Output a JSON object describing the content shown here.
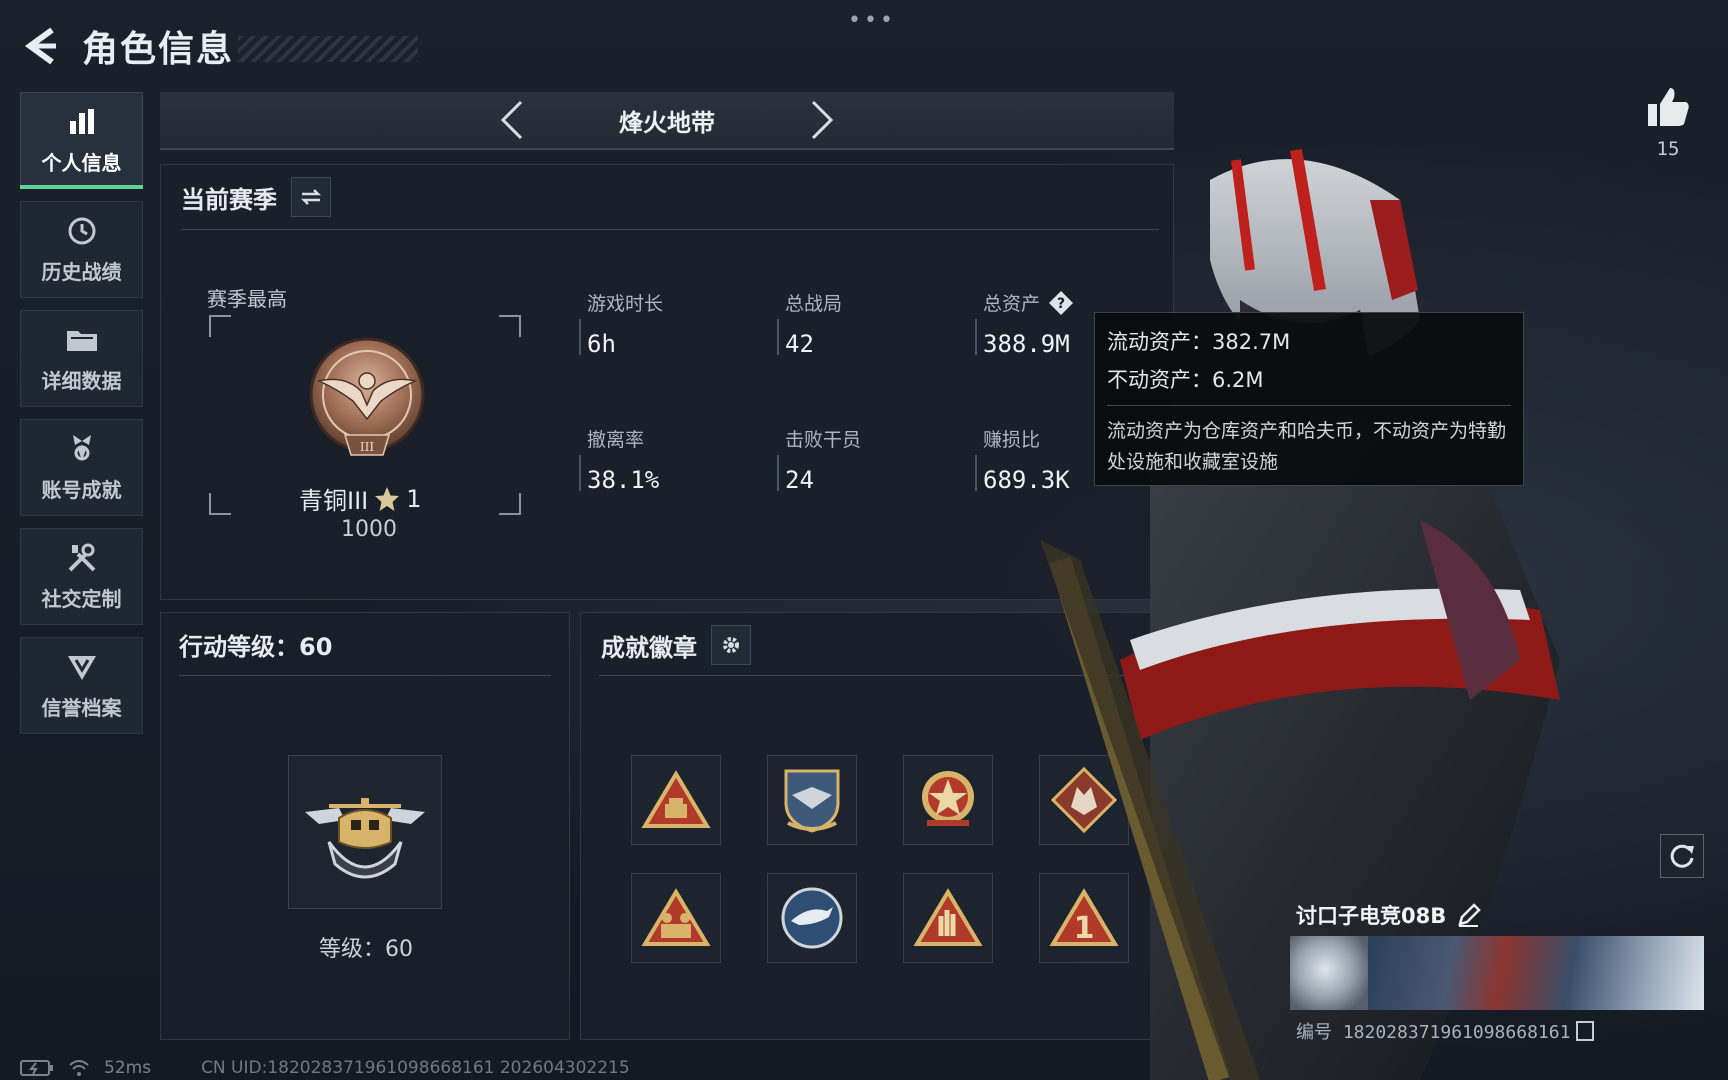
{
  "header": {
    "title": "角色信息",
    "more": "•••"
  },
  "sidebar": {
    "items": [
      {
        "label": "个人信息",
        "icon": "bar-chart-icon",
        "active": true
      },
      {
        "label": "历史战绩",
        "icon": "history-clock-icon",
        "active": false
      },
      {
        "label": "详细数据",
        "icon": "folder-icon",
        "active": false
      },
      {
        "label": "账号成就",
        "icon": "achievement-medal-icon",
        "active": false
      },
      {
        "label": "社交定制",
        "icon": "tools-icon",
        "active": false
      },
      {
        "label": "信誉档案",
        "icon": "credit-shield-icon",
        "active": false
      }
    ]
  },
  "mode": {
    "name": "烽火地带"
  },
  "season": {
    "title": "当前赛季",
    "best_label": "赛季最高",
    "rank_name": "青铜III",
    "rank_stars": "1",
    "rank_score": "1000",
    "stats": {
      "play_time": {
        "label": "游戏时长",
        "value": "6h"
      },
      "total_matches": {
        "label": "总战局",
        "value": "42"
      },
      "total_assets": {
        "label": "总资产",
        "value": "388.9M"
      },
      "extract_rate": {
        "label": "撤离率",
        "value": "38.1%"
      },
      "kills": {
        "label": "击败干员",
        "value": "24"
      },
      "profit_ratio": {
        "label": "赚损比",
        "value": "689.3K"
      }
    }
  },
  "tooltip": {
    "liquid": "流动资产：382.7M",
    "fixed": "不动资产：6.2M",
    "description": "流动资产为仓库资产和哈夫币，不动资产为特勤处设施和收藏室设施"
  },
  "action_level": {
    "title": "行动等级：60",
    "level_text": "等级：60"
  },
  "badges": {
    "title": "成就徽章",
    "items": [
      "triangle-chest-badge-icon",
      "shield-eagle-badge-icon",
      "star-wreath-badge-icon",
      "wolf-diamond-badge-icon",
      "triangle-soldiers-badge-icon",
      "eagle-round-badge-icon",
      "triangle-hand-badge-icon",
      "triangle-one-badge-icon"
    ]
  },
  "profile": {
    "likes": "15",
    "player_name": "讨口子电竞08B",
    "player_id": "编号 1820283719610986681​61"
  },
  "footer": {
    "ping": "52ms",
    "uid": "CN UID:1820283719610986681​61  202604302215"
  },
  "colors": {
    "accent_green": "#5fd39a",
    "bronze": "#b88a6a",
    "badge_red": "#b23a2a",
    "badge_gold": "#d8b46a"
  }
}
